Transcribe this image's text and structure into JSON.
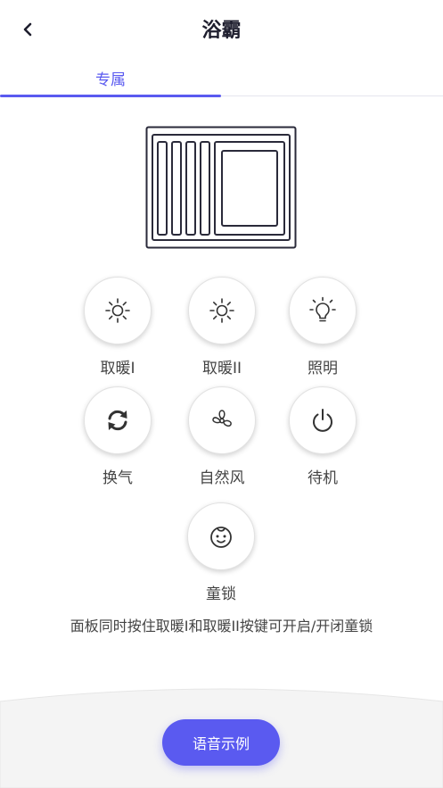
{
  "header": {
    "title": "浴霸",
    "back_icon": "chevron-left-icon"
  },
  "tabs": [
    {
      "label": "专属",
      "active": true
    }
  ],
  "device": {
    "icon": "bath-heater-device-icon"
  },
  "controls": [
    {
      "label": "取暖I",
      "icon": "sun-icon"
    },
    {
      "label": "取暖II",
      "icon": "sun-icon"
    },
    {
      "label": "照明",
      "icon": "lightbulb-icon"
    },
    {
      "label": "换气",
      "icon": "refresh-icon"
    },
    {
      "label": "自然风",
      "icon": "fan-icon"
    },
    {
      "label": "待机",
      "icon": "power-icon"
    },
    {
      "label": "童锁",
      "icon": "child-face-icon"
    }
  ],
  "hint": "面板同时按住取暖I和取暖II按键可开启/开闭童锁",
  "voice_button": {
    "label": "语音示例"
  },
  "colors": {
    "accent": "#5a5af0",
    "text": "#444444",
    "title": "#1e1e2e"
  }
}
